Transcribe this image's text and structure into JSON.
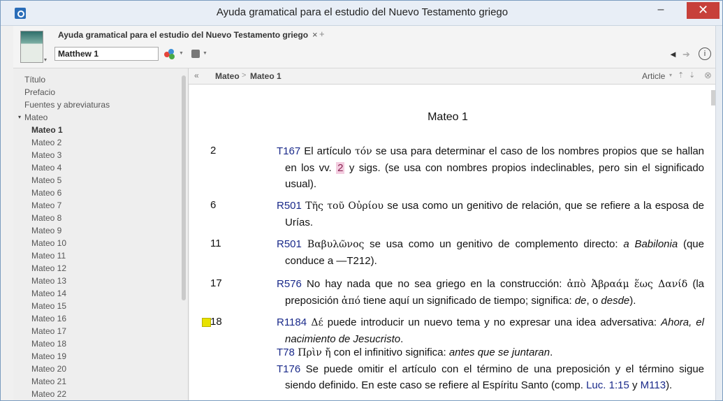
{
  "window": {
    "title": "Ayuda gramatical para el estudio del Nuevo Testamento griego",
    "minimize": "–",
    "close": "✕"
  },
  "toolbar": {
    "tab_label": "Ayuda gramatical para el estudio del Nuevo Testamento griego",
    "tab_close": "×",
    "tab_add": "+",
    "reference_value": "Matthew 1",
    "back": "◄",
    "forward": "➔",
    "info": "i",
    "icons": {
      "visual_filter": "visual-filter-icon",
      "panel": "panel-menu-icon"
    }
  },
  "sidebar": {
    "top_items": [
      "Título",
      "Prefacio",
      "Fuentes y abreviaturas"
    ],
    "expanded_item": "Mateo",
    "expander": "▾",
    "chapters": [
      "Mateo 1",
      "Mateo 2",
      "Mateo 3",
      "Mateo 4",
      "Mateo 5",
      "Mateo 6",
      "Mateo 7",
      "Mateo 8",
      "Mateo 9",
      "Mateo 10",
      "Mateo 11",
      "Mateo 12",
      "Mateo 13",
      "Mateo 14",
      "Mateo 15",
      "Mateo 16",
      "Mateo 17",
      "Mateo 18",
      "Mateo 19",
      "Mateo 20",
      "Mateo 21",
      "Mateo 22"
    ],
    "current": "Mateo 1"
  },
  "navbar": {
    "collapse": "«",
    "crumbs": [
      "Mateo",
      "Mateo 1"
    ],
    "separator": ">",
    "article": "Article",
    "article_caret": "▾",
    "up": "⇡",
    "down": "⇣",
    "close": "⊗"
  },
  "content": {
    "heading": "Mateo 1",
    "verses": {
      "v2": "2",
      "v6": "6",
      "v11": "11",
      "v17": "17",
      "v18": "18"
    },
    "n2": {
      "code": "T167",
      "t1": " El artículo ",
      "greek": "τόν",
      "t2": " se usa para determinar el caso de los nombres propios que se hallan en los vv. ",
      "hl": "2",
      "t3": " y sigs. (se usa con nombres propios indeclinables, pero sin el significado usual)."
    },
    "n6": {
      "code": "R501",
      "greek": " Τῆς τοῦ Οὐρίου",
      "t1": " se usa como un genitivo de relación, que se refiere a la esposa de Urías."
    },
    "n11": {
      "code": "R501",
      "greek": " Βαβυλῶνος",
      "t1": " se usa como un genitivo de complemento directo: ",
      "em": "a Babilonia",
      "t2": " (que conduce a —T212)."
    },
    "n17": {
      "code": "R576",
      "t1": " No hay nada que no sea griego en la construcción: ",
      "greek1": "ἀπὸ Ἀβραάμ ἕως Δανίδ",
      "t2": " (la preposición ",
      "greek2": "ἀπό",
      "t3": " tiene aquí un significado de tiempo; significa: ",
      "em1": "de",
      "t4": ", o ",
      "em2": "desde",
      "t5": ")."
    },
    "n18a": {
      "code": "R1184",
      "greek": " Δέ",
      "t1": " puede introducir un nuevo tema y no expresar una idea adversativa: ",
      "em": "Ahora, el nacimiento de Jesucristo",
      "t2": "."
    },
    "n18b": {
      "code": "T78",
      "greek": " Πρὶν ἤ",
      "t1": " con el infinitivo significa: ",
      "em": "antes que se juntaran",
      "t2": "."
    },
    "n18c": {
      "code": "T176",
      "t1": " Se puede omitir el artículo con el término de una preposición y el término sigue siendo definido. En este caso se refiere al Espíritu Santo (comp. ",
      "link1": "Luc. 1:15",
      "t2": " y ",
      "link2": "M113",
      "t3": ")."
    }
  },
  "colors": {
    "accent_code": "#1a2a8a",
    "highlight": "#f3cde0",
    "marker": "#e8e200",
    "close_button": "#c7403a"
  }
}
